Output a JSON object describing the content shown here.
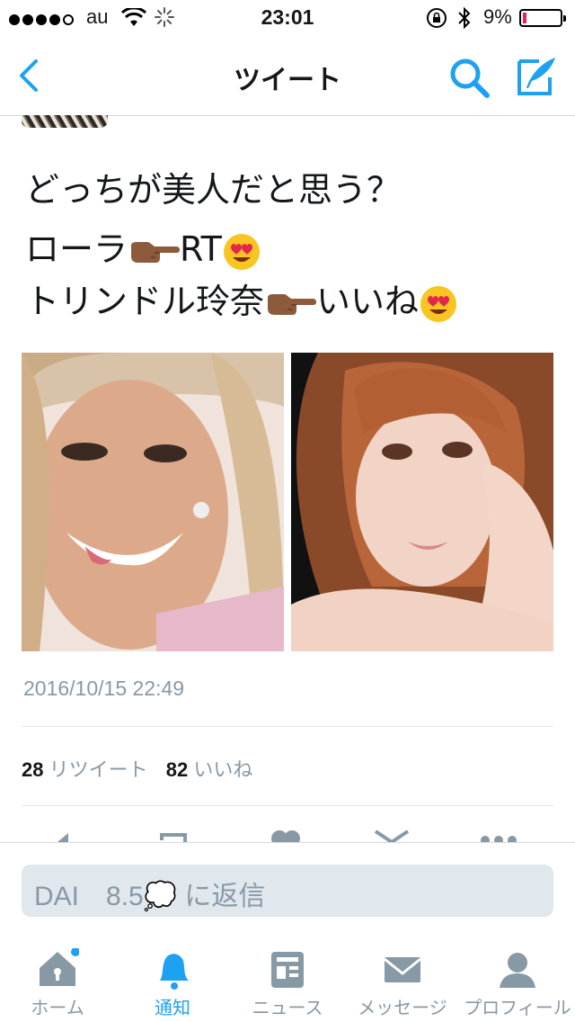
{
  "status_bar": {
    "carrier": "au",
    "time": "23:01",
    "battery_percent": "9%",
    "battery_level": 0.09,
    "signal_bars": 4
  },
  "nav": {
    "title": "ツイート",
    "back_icon": "chevron-left-icon",
    "search_icon": "search-icon",
    "compose_icon": "compose-tweet-icon"
  },
  "tweet": {
    "line1": "どっちが美人だと思う？",
    "line2_prefix": "ローラ",
    "line2_suffix": "RT",
    "line3_prefix": "トリンドル玲奈",
    "line3_suffix": "いいね",
    "timestamp": "2016/10/15 22:49",
    "retweet_count": "28",
    "retweet_label": "リツイート",
    "like_count": "82",
    "like_label": "いいね"
  },
  "reply": {
    "placeholder": "DAI　8.5💭 に返信"
  },
  "tabs": [
    {
      "label": "ホーム",
      "icon": "home-icon",
      "active": false
    },
    {
      "label": "通知",
      "icon": "bell-icon",
      "active": true
    },
    {
      "label": "ニュース",
      "icon": "news-icon",
      "active": false
    },
    {
      "label": "メッセージ",
      "icon": "envelope-icon",
      "active": false
    },
    {
      "label": "プロフィール",
      "icon": "profile-icon",
      "active": false
    }
  ],
  "colors": {
    "accent": "#1da1f2",
    "muted": "#8899a6",
    "battery_low": "#e0245e"
  }
}
